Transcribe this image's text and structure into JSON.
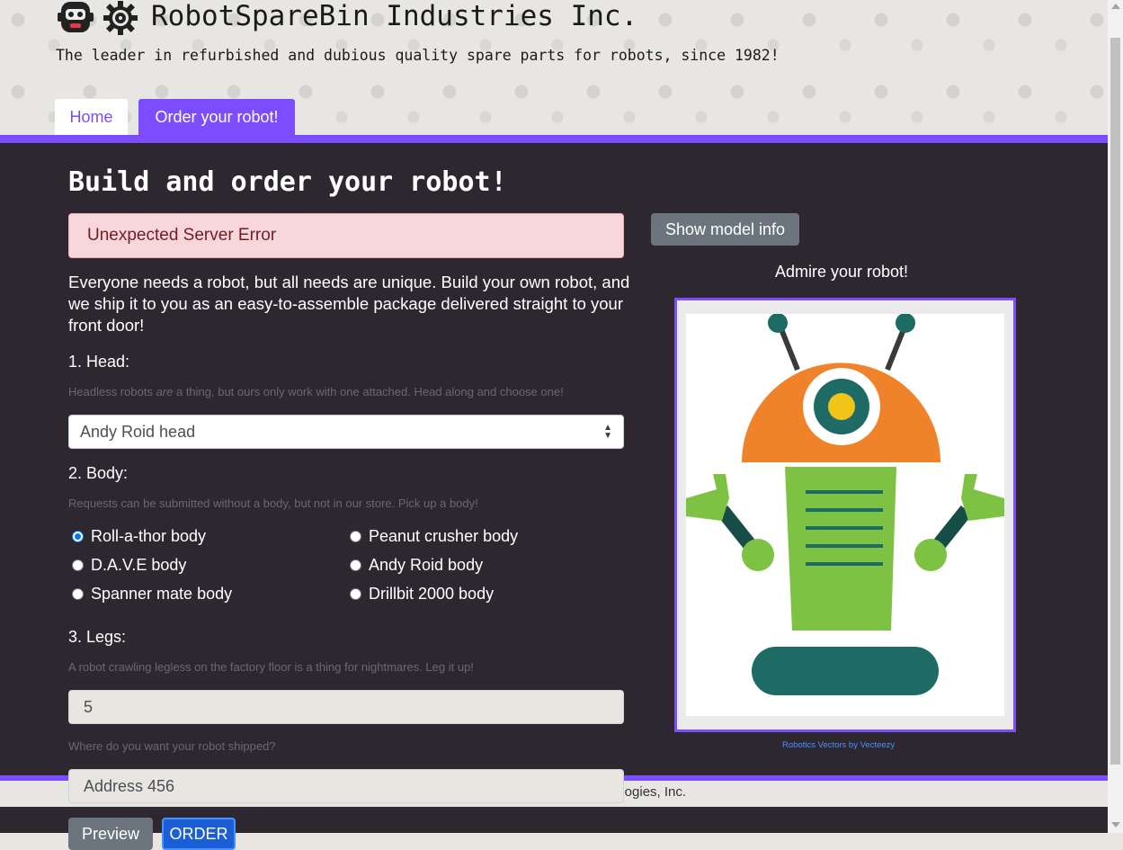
{
  "header": {
    "title": "RobotSpareBin Industries Inc.",
    "tagline": "The leader in refurbished and dubious quality spare parts for robots, since 1982!",
    "logo_icon": "robot-icon",
    "gear_icon": "gear-icon"
  },
  "tabs": [
    {
      "label": "Home",
      "active": false
    },
    {
      "label": "Order your robot!",
      "active": true
    }
  ],
  "main": {
    "page_title": "Build and order your robot!",
    "error_alert": "Unexpected Server Error",
    "intro": "Everyone needs a robot, but all needs are unique. Build your own robot, and we ship it to you as an easy-to-assemble package delivered straight to your front door!",
    "head": {
      "label": "1. Head:",
      "hint_before": "Headless robots ",
      "hint_em": "are",
      "hint_after": " a thing, but ours only work with one attached. Head along and choose one!",
      "selected": "Andy Roid head"
    },
    "body": {
      "label": "2. Body:",
      "hint": "Requests can be submitted without a body, but not in our store. Pick up a body!",
      "options": [
        {
          "label": "Roll-a-thor body",
          "checked": true
        },
        {
          "label": "Peanut crusher body",
          "checked": false
        },
        {
          "label": "D.A.V.E body",
          "checked": false
        },
        {
          "label": "Andy Roid body",
          "checked": false
        },
        {
          "label": "Spanner mate body",
          "checked": false
        },
        {
          "label": "Drillbit 2000 body",
          "checked": false
        }
      ]
    },
    "legs": {
      "label": "3. Legs:",
      "hint": "A robot crawling legless on the factory floor is a thing for nightmares. Leg it up!",
      "value": "5"
    },
    "address": {
      "hint": "Where do you want your robot shipped?",
      "value": "Address 456"
    },
    "buttons": {
      "preview": "Preview",
      "order": "ORDER"
    }
  },
  "preview_panel": {
    "show_model_info": "Show model info",
    "admire": "Admire your robot!",
    "credit": "Robotics Vectors by Vecteezy"
  },
  "footer": {
    "text": "ologies, Inc."
  },
  "colors": {
    "accent": "#7c4dff",
    "main_bg": "#2d2830",
    "alert_bg": "#f8d7da",
    "robot_orange": "#f0832a",
    "robot_green": "#7dc242",
    "robot_teal": "#1e6b66"
  }
}
